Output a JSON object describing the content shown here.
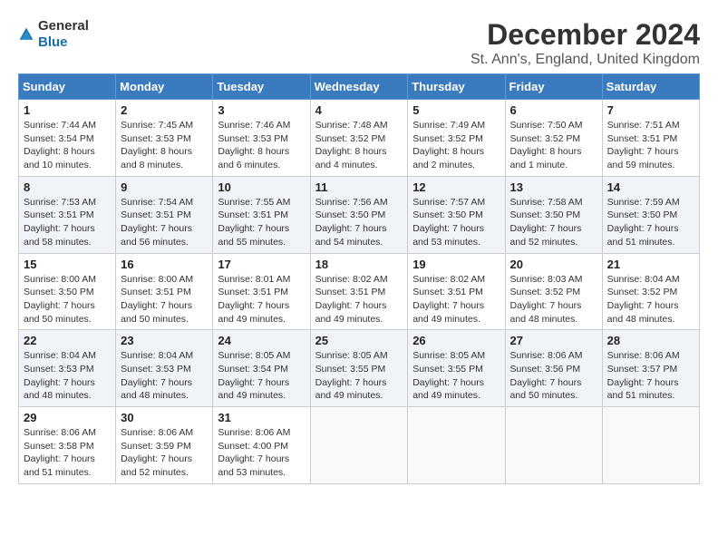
{
  "logo": {
    "text_general": "General",
    "text_blue": "Blue"
  },
  "title": "December 2024",
  "subtitle": "St. Ann's, England, United Kingdom",
  "days_of_week": [
    "Sunday",
    "Monday",
    "Tuesday",
    "Wednesday",
    "Thursday",
    "Friday",
    "Saturday"
  ],
  "weeks": [
    [
      {
        "day": "1",
        "sunrise": "7:44 AM",
        "sunset": "3:54 PM",
        "daylight": "8 hours and 10 minutes."
      },
      {
        "day": "2",
        "sunrise": "7:45 AM",
        "sunset": "3:53 PM",
        "daylight": "8 hours and 8 minutes."
      },
      {
        "day": "3",
        "sunrise": "7:46 AM",
        "sunset": "3:53 PM",
        "daylight": "8 hours and 6 minutes."
      },
      {
        "day": "4",
        "sunrise": "7:48 AM",
        "sunset": "3:52 PM",
        "daylight": "8 hours and 4 minutes."
      },
      {
        "day": "5",
        "sunrise": "7:49 AM",
        "sunset": "3:52 PM",
        "daylight": "8 hours and 2 minutes."
      },
      {
        "day": "6",
        "sunrise": "7:50 AM",
        "sunset": "3:52 PM",
        "daylight": "8 hours and 1 minute."
      },
      {
        "day": "7",
        "sunrise": "7:51 AM",
        "sunset": "3:51 PM",
        "daylight": "7 hours and 59 minutes."
      }
    ],
    [
      {
        "day": "8",
        "sunrise": "7:53 AM",
        "sunset": "3:51 PM",
        "daylight": "7 hours and 58 minutes."
      },
      {
        "day": "9",
        "sunrise": "7:54 AM",
        "sunset": "3:51 PM",
        "daylight": "7 hours and 56 minutes."
      },
      {
        "day": "10",
        "sunrise": "7:55 AM",
        "sunset": "3:51 PM",
        "daylight": "7 hours and 55 minutes."
      },
      {
        "day": "11",
        "sunrise": "7:56 AM",
        "sunset": "3:50 PM",
        "daylight": "7 hours and 54 minutes."
      },
      {
        "day": "12",
        "sunrise": "7:57 AM",
        "sunset": "3:50 PM",
        "daylight": "7 hours and 53 minutes."
      },
      {
        "day": "13",
        "sunrise": "7:58 AM",
        "sunset": "3:50 PM",
        "daylight": "7 hours and 52 minutes."
      },
      {
        "day": "14",
        "sunrise": "7:59 AM",
        "sunset": "3:50 PM",
        "daylight": "7 hours and 51 minutes."
      }
    ],
    [
      {
        "day": "15",
        "sunrise": "8:00 AM",
        "sunset": "3:50 PM",
        "daylight": "7 hours and 50 minutes."
      },
      {
        "day": "16",
        "sunrise": "8:00 AM",
        "sunset": "3:51 PM",
        "daylight": "7 hours and 50 minutes."
      },
      {
        "day": "17",
        "sunrise": "8:01 AM",
        "sunset": "3:51 PM",
        "daylight": "7 hours and 49 minutes."
      },
      {
        "day": "18",
        "sunrise": "8:02 AM",
        "sunset": "3:51 PM",
        "daylight": "7 hours and 49 minutes."
      },
      {
        "day": "19",
        "sunrise": "8:02 AM",
        "sunset": "3:51 PM",
        "daylight": "7 hours and 49 minutes."
      },
      {
        "day": "20",
        "sunrise": "8:03 AM",
        "sunset": "3:52 PM",
        "daylight": "7 hours and 48 minutes."
      },
      {
        "day": "21",
        "sunrise": "8:04 AM",
        "sunset": "3:52 PM",
        "daylight": "7 hours and 48 minutes."
      }
    ],
    [
      {
        "day": "22",
        "sunrise": "8:04 AM",
        "sunset": "3:53 PM",
        "daylight": "7 hours and 48 minutes."
      },
      {
        "day": "23",
        "sunrise": "8:04 AM",
        "sunset": "3:53 PM",
        "daylight": "7 hours and 48 minutes."
      },
      {
        "day": "24",
        "sunrise": "8:05 AM",
        "sunset": "3:54 PM",
        "daylight": "7 hours and 49 minutes."
      },
      {
        "day": "25",
        "sunrise": "8:05 AM",
        "sunset": "3:55 PM",
        "daylight": "7 hours and 49 minutes."
      },
      {
        "day": "26",
        "sunrise": "8:05 AM",
        "sunset": "3:55 PM",
        "daylight": "7 hours and 49 minutes."
      },
      {
        "day": "27",
        "sunrise": "8:06 AM",
        "sunset": "3:56 PM",
        "daylight": "7 hours and 50 minutes."
      },
      {
        "day": "28",
        "sunrise": "8:06 AM",
        "sunset": "3:57 PM",
        "daylight": "7 hours and 51 minutes."
      }
    ],
    [
      {
        "day": "29",
        "sunrise": "8:06 AM",
        "sunset": "3:58 PM",
        "daylight": "7 hours and 51 minutes."
      },
      {
        "day": "30",
        "sunrise": "8:06 AM",
        "sunset": "3:59 PM",
        "daylight": "7 hours and 52 minutes."
      },
      {
        "day": "31",
        "sunrise": "8:06 AM",
        "sunset": "4:00 PM",
        "daylight": "7 hours and 53 minutes."
      },
      null,
      null,
      null,
      null
    ]
  ],
  "labels": {
    "sunrise": "Sunrise:",
    "sunset": "Sunset:",
    "daylight": "Daylight:"
  }
}
